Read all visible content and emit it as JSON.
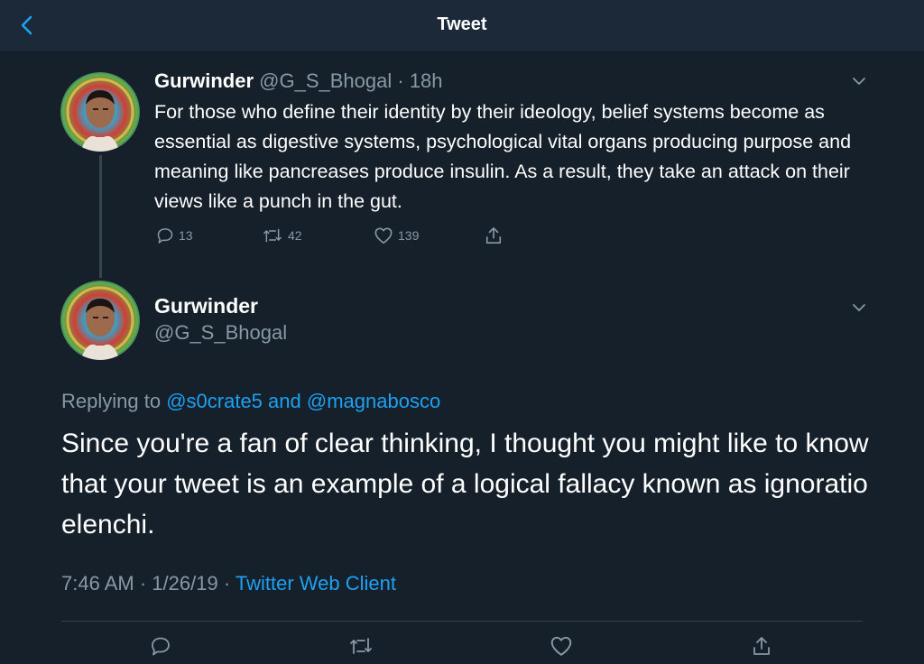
{
  "header": {
    "title": "Tweet"
  },
  "parent_tweet": {
    "name": "Gurwinder",
    "handle": "@G_S_Bhogal",
    "separator": "·",
    "time": "18h",
    "text": "For those who define their identity by their ideology, belief systems become as essential as digestive systems, psychological vital organs producing purpose and meaning like pancreases produce insulin. As a result, they take an attack on their views like a punch in the gut.",
    "replies": "13",
    "retweets": "42",
    "likes": "139"
  },
  "main_tweet": {
    "name": "Gurwinder",
    "handle": "@G_S_Bhogal",
    "replying_prefix": "Replying to",
    "reply_user_1": "@s0crate5",
    "reply_and": "and",
    "reply_user_2": "@magnabosco",
    "text": "Since you're a fan of clear thinking, I thought you might like to know that your tweet is an example of a logical fallacy known as ignoratio elenchi.",
    "time": "7:46 AM",
    "dot": "·",
    "date": "1/26/19",
    "source": "Twitter Web Client"
  },
  "colors": {
    "background": "#15202b",
    "header_bg": "#1c2938",
    "accent": "#1da1f2",
    "muted": "#8899a6",
    "divider": "#38444d"
  },
  "icons": [
    "back-chevron-icon",
    "chevron-down-icon",
    "reply-icon",
    "retweet-icon",
    "like-icon",
    "share-icon"
  ]
}
